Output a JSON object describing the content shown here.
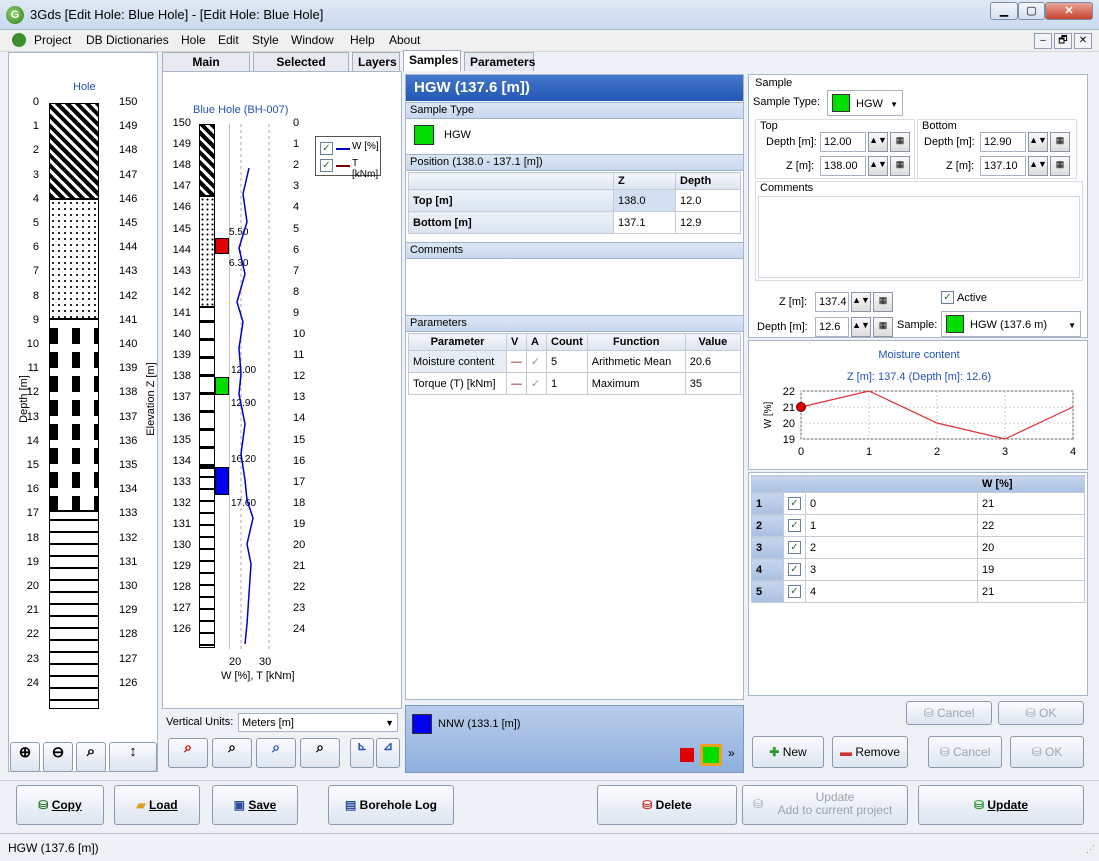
{
  "window": {
    "title": "3Gds [Edit Hole: Blue Hole] - [Edit Hole: Blue Hole]",
    "minimize": "▁",
    "maximize": "▢",
    "close": "✕",
    "mdi": [
      "–",
      "🗗",
      "✕"
    ]
  },
  "menu": [
    "Project",
    "DB Dictionaries",
    "Hole",
    "Edit",
    "Style",
    "Window",
    "Help",
    "About"
  ],
  "tabs": [
    "Main Features",
    "Selected Layer",
    "Layers",
    "Samples",
    "Parameters"
  ],
  "hole": {
    "title": "Hole",
    "depth_label": "Depth [m]",
    "elev_label": "Elevation Z [m]",
    "depths": [
      "0",
      "1",
      "2",
      "3",
      "4",
      "5",
      "6",
      "7",
      "8",
      "9",
      "10",
      "11",
      "12",
      "13",
      "14",
      "15",
      "16",
      "17",
      "18",
      "19",
      "20",
      "21",
      "22",
      "23",
      "24"
    ],
    "elevs": [
      "150",
      "149",
      "148",
      "147",
      "146",
      "145",
      "144",
      "143",
      "142",
      "141",
      "140",
      "139",
      "138",
      "137",
      "136",
      "135",
      "134",
      "133",
      "132",
      "131",
      "130",
      "129",
      "128",
      "127",
      "126"
    ]
  },
  "log": {
    "title": "Blue Hole (BH-007)",
    "xlabel": "W [%], T [kNm]",
    "xticks": [
      "20",
      "30"
    ],
    "left_ticks": [
      "150",
      "149",
      "148",
      "147",
      "146",
      "145",
      "144",
      "143",
      "142",
      "141",
      "140",
      "139",
      "138",
      "137",
      "136",
      "135",
      "134",
      "133",
      "132",
      "131",
      "130",
      "129",
      "128",
      "127",
      "126"
    ],
    "right_ticks": [
      "0",
      "1",
      "2",
      "3",
      "4",
      "5",
      "6",
      "7",
      "8",
      "9",
      "10",
      "11",
      "12",
      "13",
      "14",
      "15",
      "16",
      "17",
      "18",
      "19",
      "20",
      "21",
      "22",
      "23",
      "24"
    ],
    "legend": [
      "W [%]",
      "T [kNm]"
    ],
    "annotations": [
      "5.50",
      "6.30",
      "12.00",
      "12.90",
      "16.20",
      "17.60"
    ],
    "units_label": "Vertical Units:",
    "units_value": "Meters [m]"
  },
  "sample": {
    "header": "HGW (137.6 [m])",
    "type_section": "Sample Type",
    "type_name": "HGW",
    "color": "#00dd00",
    "position_section": "Position (138.0 - 137.1 [m])",
    "pos_headers": [
      "",
      "Z",
      "Depth"
    ],
    "pos_rows": [
      [
        "Top [m]",
        "138.0",
        "12.0"
      ],
      [
        "Bottom [m]",
        "137.1",
        "12.9"
      ]
    ],
    "comments_section": "Comments",
    "parameters_section": "Parameters",
    "param_headers": [
      "Parameter",
      "V",
      "A",
      "Count",
      "Function",
      "Value"
    ],
    "param_rows": [
      [
        "Moisture content",
        "—",
        "✓",
        "5",
        "Arithmetic Mean",
        "20.6"
      ],
      [
        "Torque (T) [kNm]",
        "—",
        "✓",
        "1",
        "Maximum",
        "35"
      ]
    ],
    "next_sample": "NNW (133.1 [m])",
    "next_color": "#0000ee"
  },
  "editor": {
    "group": "Sample",
    "type_label": "Sample Type:",
    "type_value": "HGW",
    "top_label": "Top",
    "bottom_label": "Bottom",
    "depth_label": "Depth [m]:",
    "z_label": "Z [m]:",
    "top_depth": "12.00",
    "top_z": "138.00",
    "bottom_depth": "12.90",
    "bottom_z": "137.10",
    "comments_label": "Comments",
    "z_value": "137.4",
    "depth_value": "12.6",
    "active_label": "Active",
    "sample_label": "Sample:",
    "sample_value": "HGW (137.6 m)",
    "chart_title": "Moisture content",
    "chart_subtitle": "Z [m]: 137.4 (Depth [m]: 12.6)",
    "grid_header": "W [%]",
    "grid_rows": [
      [
        "1",
        "0",
        "21"
      ],
      [
        "2",
        "1",
        "22"
      ],
      [
        "3",
        "2",
        "20"
      ],
      [
        "4",
        "3",
        "19"
      ],
      [
        "5",
        "4",
        "21"
      ]
    ],
    "cancel": "Cancel",
    "ok": "OK",
    "new": "New",
    "remove": "Remove"
  },
  "chart_data": {
    "type": "line",
    "x": [
      0,
      1,
      2,
      3,
      4
    ],
    "series": [
      {
        "values": [
          21,
          22,
          20,
          19,
          21
        ]
      }
    ],
    "xlabel": "",
    "ylabel": "W [%]",
    "xlim": [
      0,
      4
    ],
    "ylim": [
      19,
      22
    ],
    "yticks": [
      19,
      20,
      21,
      22
    ],
    "xticks": [
      0,
      1,
      2,
      3,
      4
    ],
    "grid": true,
    "color": "#e03030"
  },
  "buttons": {
    "copy": "Copy",
    "load": "Load",
    "save": "Save",
    "borehole_log": "Borehole Log",
    "delete": "Delete",
    "update_add1": "Update",
    "update_add2": "Add to current project",
    "update": "Update"
  },
  "status": "HGW (137.6 [m])"
}
